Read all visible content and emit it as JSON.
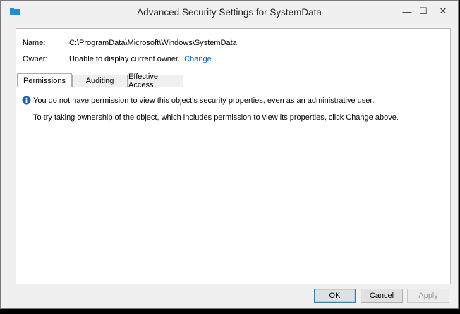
{
  "window": {
    "title": "Advanced Security Settings for SystemData",
    "controls": {
      "minimize": "—",
      "maximize": "☐",
      "close": "✕"
    }
  },
  "details": {
    "name_label": "Name:",
    "name_value": "C:\\ProgramData\\Microsoft\\Windows\\SystemData",
    "owner_label": "Owner:",
    "owner_value": "Unable to display current owner.",
    "change_link": "Change"
  },
  "tabs": [
    {
      "label": "Permissions",
      "active": true
    },
    {
      "label": "Auditing",
      "active": false
    },
    {
      "label": "Effective Access",
      "active": false
    }
  ],
  "messages": {
    "info": "You do not have permission to view this object's security properties, even as an administrative user.",
    "hint": "To try taking ownership of the object, which includes permission to view its properties, click Change above."
  },
  "buttons": {
    "ok": "OK",
    "cancel": "Cancel",
    "apply": "Apply"
  },
  "colors": {
    "link": "#0066cc",
    "info_icon": "#1f5fb5",
    "folder_icon": "#1e8fd6"
  },
  "icons": [
    "folder-icon",
    "info-icon"
  ]
}
